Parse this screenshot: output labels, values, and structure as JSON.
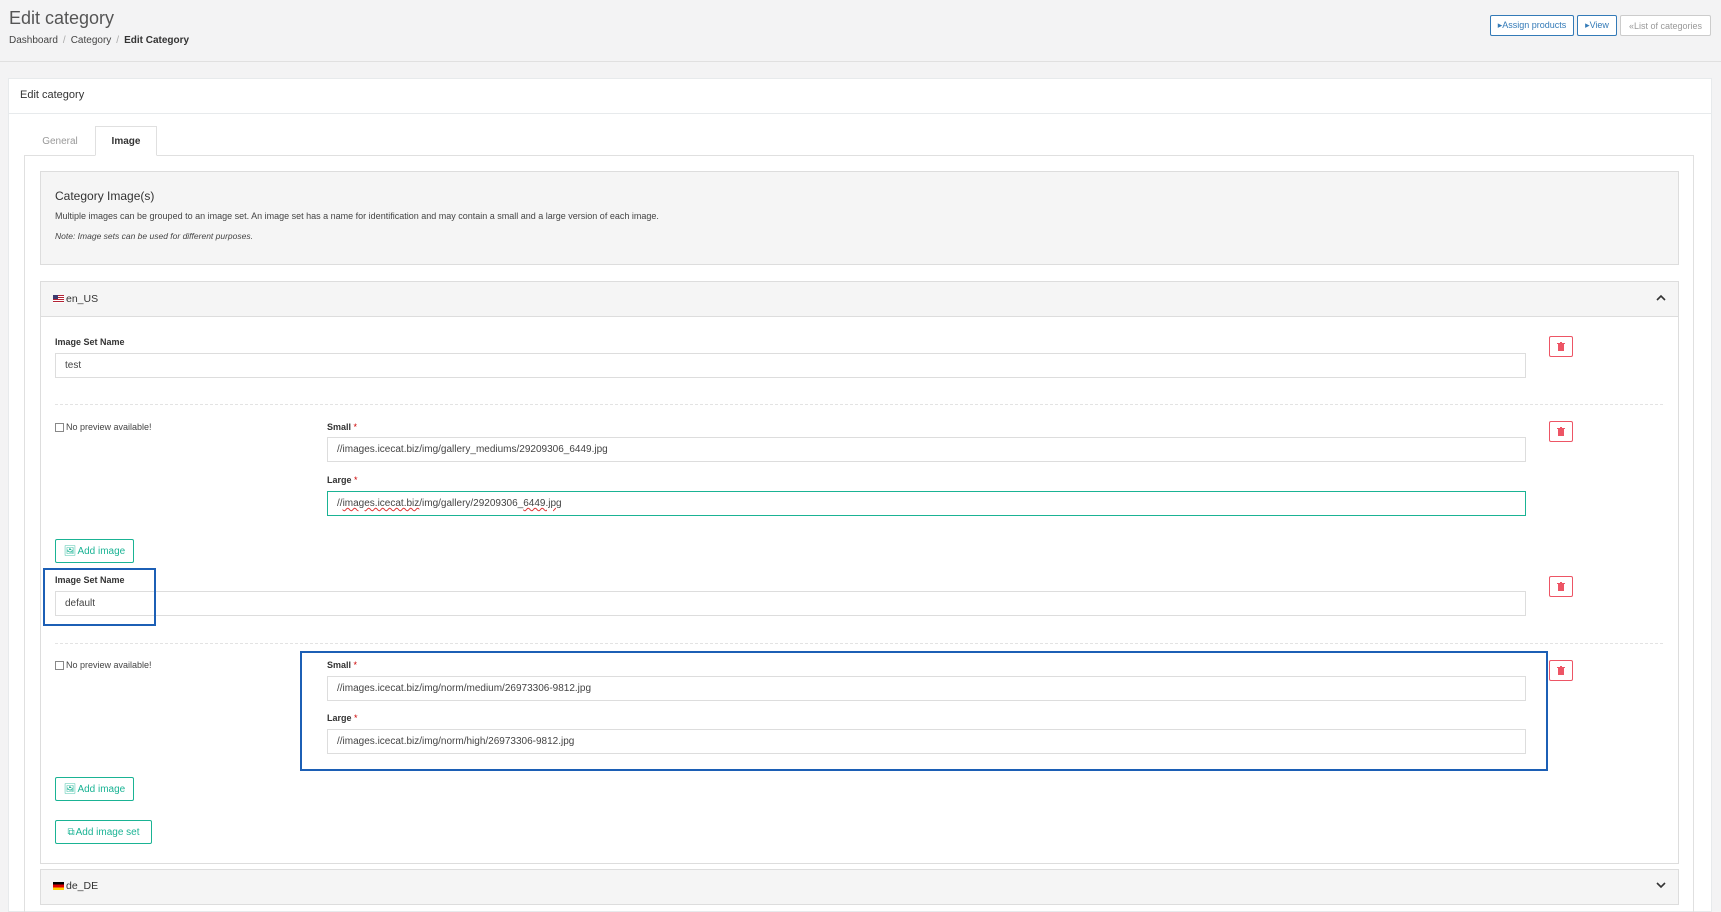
{
  "header": {
    "title": "Edit category",
    "breadcrumb": [
      "Dashboard",
      "Category",
      "Edit Category"
    ],
    "buttons": {
      "assign_products": "▸Assign products",
      "view": "▸View",
      "list_categories": "«List of categories"
    }
  },
  "box": {
    "title": "Edit category",
    "tabs": [
      "General",
      "Image"
    ],
    "active_tab": "Image"
  },
  "info": {
    "title": "Category Image(s)",
    "description": "Multiple images can be grouped to an image set. An image set has a name for identification and may contain a small and a large version of each image.",
    "note": "Note: Image sets can be used for different purposes."
  },
  "locales": {
    "en_us": {
      "label": "en_US",
      "expanded": true,
      "chevron": "⌃",
      "image_sets": [
        {
          "name_label": "Image Set Name",
          "name_value": "test",
          "images": [
            {
              "preview": "No preview available!",
              "small_label": "Small",
              "small_value": "//images.icecat.biz/img/gallery_mediums/29209306_6449.jpg",
              "large_label": "Large",
              "large_value_parts": [
                "//",
                "images.icecat.biz",
                "/img/gallery/29209306_",
                "6449.jpg"
              ]
            }
          ],
          "add_image": "Add image"
        },
        {
          "name_label": "Image Set Name",
          "name_value": "default",
          "images": [
            {
              "preview": "No preview available!",
              "small_label": "Small",
              "small_value": "//images.icecat.biz/img/norm/medium/26973306-9812.jpg",
              "large_label": "Large",
              "large_value": "//images.icecat.biz/img/norm/high/26973306-9812.jpg"
            }
          ],
          "add_image": "Add image"
        }
      ],
      "add_image_set": "Add image set"
    },
    "de_de": {
      "label": "de_DE",
      "expanded": false,
      "chevron": "⌄"
    }
  },
  "required_marker": "*",
  "colors": {
    "primary": "#337ab7",
    "success": "#1ab394",
    "danger": "#ed5565",
    "highlight": "#1c5fb5"
  }
}
